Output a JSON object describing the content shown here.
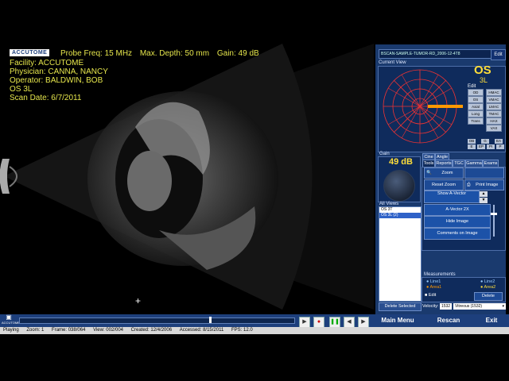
{
  "header": {
    "logo": "ACCUTOME",
    "probe_freq": "Probe Freq: 15 MHz",
    "max_depth": "Max. Depth: 50 mm",
    "gain": "Gain: 49 dB",
    "facility": "Facility: ACCUTOME",
    "physician": "Physician: CANNA, NANCY",
    "operator": "Operator: BALDWIN, BOB",
    "eye_view": "OS  3L",
    "scan_date": "Scan Date: 6/7/2011"
  },
  "panel": {
    "file_name": "BSCAN-SAMPLE-TUMOR-RD_2006-12-4T8",
    "edit_top": "Edit",
    "current_view_label": "Current View",
    "eye": "OS",
    "view": "3L",
    "edit_label": "Edit",
    "edit_grid": [
      "OD",
      "HMAC",
      "OS",
      "VMAC",
      "Axial",
      "LMAC",
      "Long",
      "TMAC",
      "Trans",
      "HAX",
      "",
      "VAX"
    ],
    "clock_small": [
      "OB",
      "G",
      "EA",
      "E",
      "EP",
      "PI",
      "P"
    ],
    "gain_label": "Gain",
    "gain_value": "49 dB",
    "tabs_row1": [
      "Cine",
      "Angle"
    ],
    "tabs_row2": [
      "Tools",
      "Reports",
      "TGC",
      "Gamma",
      "Exams"
    ],
    "zoom_button": "Zoom",
    "reset_zoom_button": "Reset Zoom",
    "print_image_button": "Print Image",
    "show_avector_button": "Show A-Vector",
    "avector_2x_button": "A-Vector 2X",
    "hide_image_button": "Hide Image",
    "comments_button": "Comments on Image",
    "all_views_label": "All Views",
    "views": [
      "OS 3T",
      "OS 3L (2)"
    ],
    "delete_selected_button": "Delete Selected",
    "measurements_label": "Measurements",
    "line1": "Line1",
    "line2": "Line2",
    "area1": "Area1",
    "area2": "Area2",
    "edit_meas": "Edit",
    "delete_meas": "Delete",
    "velocity_label": "Velocity:",
    "velocity_value": "1532",
    "velocity_medium": "Vitreous (1532)"
  },
  "bottom": {
    "main_menu": "Main Menu",
    "rescan": "Rescan",
    "exit": "Exit",
    "logo_small": "ACCUTOME"
  },
  "status": {
    "state": "Playing",
    "zoom": "Zoom: 1",
    "frame": "Frame: 038/064",
    "view": "View: 002/004",
    "created": "Created: 12/4/2006",
    "accessed": "Accessed: 8/15/2011",
    "fps": "FPS: 12.0"
  },
  "colors": {
    "panel_bg": "#1a3a6e",
    "header_text": "#e6e64c",
    "accent_yellow": "#ffde3a"
  }
}
